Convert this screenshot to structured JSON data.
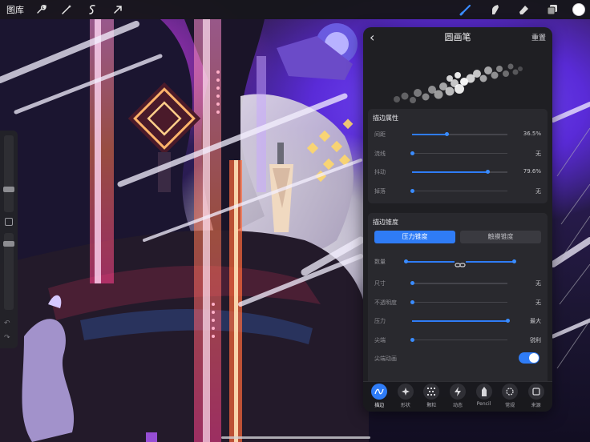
{
  "topbar": {
    "gallery_label": "图库",
    "left_tools": [
      "wrench-icon",
      "magic-wand-icon",
      "selection-icon",
      "transform-arrow-icon"
    ],
    "right_tools": [
      "brush-icon",
      "smudge-icon",
      "eraser-icon",
      "layers-icon"
    ],
    "active_color": "#ffffff"
  },
  "panel": {
    "title": "圆画笔",
    "reset_label": "重置",
    "stroke_properties": {
      "title": "描边属性",
      "rows": [
        {
          "label": "间距",
          "value": "36.5%",
          "fill": 0.365
        },
        {
          "label": "流线",
          "value": "无",
          "fill": 0
        },
        {
          "label": "抖动",
          "value": "79.6%",
          "fill": 0.796
        },
        {
          "label": "掉落",
          "value": "无",
          "fill": 0
        }
      ]
    },
    "stroke_taper": {
      "title": "描边锥度",
      "segments": [
        "压力锥度",
        "触摸锥度"
      ],
      "active_segment": "压力锥度",
      "quantity_label": "数量",
      "rows": [
        {
          "label": "尺寸",
          "value": "无",
          "fill": 0
        },
        {
          "label": "不透明度",
          "value": "无",
          "fill": 0
        },
        {
          "label": "压力",
          "value": "最大",
          "fill": 1.0
        },
        {
          "label": "尖端",
          "value": "锐利",
          "fill": 0
        }
      ],
      "tip_animation_label": "尖端动画",
      "tip_animation_on": true
    },
    "tabs": [
      {
        "label": "描边",
        "icon": "stroke-path-icon",
        "active": true
      },
      {
        "label": "形状",
        "icon": "shape-icon",
        "active": false
      },
      {
        "label": "颗粒",
        "icon": "grain-icon",
        "active": false
      },
      {
        "label": "动态",
        "icon": "dynamics-icon",
        "active": false
      },
      {
        "label": "Pencil",
        "icon": "pencil-icon",
        "active": false
      },
      {
        "label": "常规",
        "icon": "general-icon",
        "active": false
      },
      {
        "label": "来源",
        "icon": "source-icon",
        "active": false
      }
    ]
  },
  "accent_color": "#2f7cf6"
}
